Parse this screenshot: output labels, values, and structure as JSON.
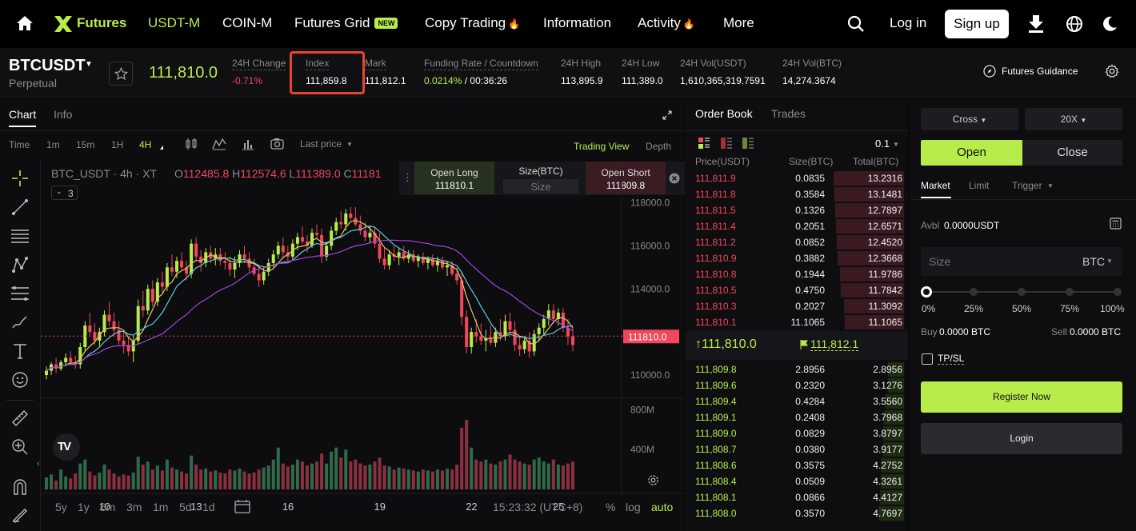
{
  "nav": {
    "logo": "Futures",
    "items": [
      "USDT-M",
      "COIN-M",
      "Futures Grid",
      "Copy Trading",
      "Information",
      "Activity",
      "More"
    ],
    "new_badge": "NEW",
    "login": "Log in",
    "signup": "Sign up"
  },
  "ticker": {
    "symbol": "BTCUSDT",
    "contract": "Perpetual",
    "last_price": "111,810.0",
    "change_label": "24H Change",
    "change_value": "-0.71%",
    "index_label": "Index",
    "index_value": "111,859.8",
    "mark_label": "Mark",
    "mark_value": "111,812.1",
    "funding_label": "Funding Rate / Countdown",
    "funding_rate": "0.0214%",
    "funding_sep": " / ",
    "countdown": "00:36:26",
    "high_label": "24H High",
    "high_value": "113,895.9",
    "low_label": "24H Low",
    "low_value": "111,389.0",
    "volu_label": "24H Vol(USDT)",
    "volu_value": "1,610,365,319.7591",
    "volb_label": "24H Vol(BTC)",
    "volb_value": "14,274.3674",
    "guidance": "Futures Guidance"
  },
  "chart": {
    "tabs": [
      "Chart",
      "Info"
    ],
    "intervals": [
      "Time",
      "1m",
      "15m",
      "1H",
      "4H"
    ],
    "price_type": "Last price",
    "views": [
      "Trading View",
      "Depth"
    ],
    "legend_pair": "BTC_USDT · 4h · XT",
    "ohlc": {
      "o_label": "O",
      "o": "112485.8",
      "h_label": "H",
      "h": "112574.6",
      "l_label": "L",
      "l": "111389.0",
      "c_label": "C",
      "c": "11181"
    },
    "indicator_count": "3",
    "open_long_label": "Open Long",
    "open_long_value": "111810.1",
    "size_label": "Size(BTC)",
    "size_placeholder": "Size",
    "open_short_label": "Open Short",
    "open_short_value": "111809.8",
    "price_axis": [
      "118000.0",
      "116000.0",
      "114000.0",
      "112000.0",
      "110000.0"
    ],
    "current_price_tag": "111810.0",
    "volume_axis": [
      "800M",
      "400M"
    ],
    "date_axis": [
      "10",
      "13",
      "16",
      "19",
      "22",
      "25"
    ],
    "ranges": [
      "5y",
      "1y",
      "6m",
      "3m",
      "1m",
      "5d",
      "1d"
    ],
    "clock": "15:23:32 (UTC+8)",
    "scale_opts": [
      "%",
      "log",
      "auto"
    ]
  },
  "chart_data": {
    "type": "candlestick",
    "price_range": [
      109000,
      118500
    ],
    "candles": [
      [
        110000,
        110400,
        109800,
        110200
      ],
      [
        110200,
        110600,
        110000,
        110500
      ],
      [
        110500,
        110800,
        110100,
        110300
      ],
      [
        110300,
        110700,
        110200,
        110600
      ],
      [
        110600,
        111000,
        110400,
        110800
      ],
      [
        110800,
        111100,
        110500,
        110600
      ],
      [
        110600,
        110900,
        110300,
        110500
      ],
      [
        110500,
        111500,
        110300,
        111300
      ],
      [
        111300,
        112500,
        111100,
        112300
      ],
      [
        112300,
        112900,
        111800,
        112000
      ],
      [
        112000,
        112400,
        111400,
        111600
      ],
      [
        111600,
        112200,
        111300,
        112000
      ],
      [
        112000,
        113000,
        111800,
        112800
      ],
      [
        112800,
        113400,
        112300,
        112500
      ],
      [
        112500,
        112900,
        111800,
        112100
      ],
      [
        112100,
        112500,
        111400,
        111600
      ],
      [
        111600,
        112000,
        111000,
        111400
      ],
      [
        111400,
        111800,
        110900,
        111100
      ],
      [
        111100,
        111800,
        110600,
        111600
      ],
      [
        111600,
        113500,
        111400,
        113200
      ],
      [
        113200,
        113900,
        112700,
        113000
      ],
      [
        113000,
        114200,
        112800,
        114000
      ],
      [
        114000,
        114400,
        113200,
        113400
      ],
      [
        113400,
        114500,
        113200,
        114300
      ],
      [
        114300,
        114800,
        113800,
        114100
      ],
      [
        114100,
        115200,
        113900,
        115000
      ],
      [
        115000,
        115600,
        114600,
        114800
      ],
      [
        114800,
        115500,
        114500,
        115300
      ],
      [
        115300,
        115700,
        114900,
        115000
      ],
      [
        115000,
        115300,
        114400,
        114700
      ],
      [
        114700,
        116300,
        114500,
        116100
      ],
      [
        116100,
        116400,
        115300,
        115500
      ],
      [
        115500,
        115800,
        114800,
        115200
      ],
      [
        115200,
        115900,
        115000,
        115700
      ],
      [
        115700,
        116000,
        115200,
        115400
      ],
      [
        115400,
        115900,
        115100,
        115600
      ],
      [
        115600,
        115900,
        115100,
        115300
      ],
      [
        115300,
        115700,
        114900,
        115200
      ],
      [
        115200,
        115500,
        114600,
        114900
      ],
      [
        114900,
        115500,
        114500,
        115200
      ],
      [
        115200,
        115800,
        115000,
        115600
      ],
      [
        115600,
        116000,
        115200,
        115400
      ],
      [
        115400,
        115700,
        114800,
        115000
      ],
      [
        115000,
        115400,
        114600,
        114700
      ],
      [
        114700,
        115100,
        114100,
        114400
      ],
      [
        114400,
        115000,
        114200,
        114800
      ],
      [
        114800,
        115400,
        114600,
        115200
      ],
      [
        115200,
        115800,
        115000,
        115600
      ],
      [
        115600,
        116200,
        115400,
        116000
      ],
      [
        116000,
        116400,
        115400,
        115700
      ],
      [
        115700,
        116000,
        115300,
        115500
      ],
      [
        115500,
        116300,
        115300,
        116100
      ],
      [
        116100,
        116600,
        115800,
        116400
      ],
      [
        116400,
        116900,
        116100,
        116200
      ],
      [
        116200,
        116500,
        115700,
        116000
      ],
      [
        116000,
        116800,
        115900,
        116600
      ],
      [
        116600,
        117000,
        116300,
        116500
      ],
      [
        116500,
        116800,
        115200,
        115500
      ],
      [
        115500,
        116200,
        115300,
        116000
      ],
      [
        116000,
        116900,
        115800,
        116700
      ],
      [
        116700,
        117300,
        116500,
        117100
      ],
      [
        117100,
        117600,
        116800,
        117000
      ],
      [
        117000,
        117700,
        116700,
        117500
      ],
      [
        117500,
        117800,
        117200,
        117300
      ],
      [
        117300,
        117800,
        116900,
        117000
      ],
      [
        117000,
        117400,
        116500,
        116700
      ],
      [
        116700,
        117100,
        116200,
        116400
      ],
      [
        116400,
        116900,
        116100,
        116600
      ],
      [
        116600,
        116900,
        115900,
        116100
      ],
      [
        116100,
        116600,
        115200,
        115400
      ],
      [
        115400,
        115900,
        114900,
        115100
      ],
      [
        115100,
        115800,
        114900,
        115600
      ],
      [
        115600,
        116000,
        115300,
        115500
      ],
      [
        115500,
        115900,
        115100,
        115700
      ],
      [
        115700,
        116000,
        115300,
        115400
      ],
      [
        115400,
        115800,
        115200,
        115600
      ],
      [
        115600,
        115800,
        115200,
        115300
      ],
      [
        115300,
        115600,
        115000,
        115500
      ],
      [
        115500,
        115700,
        115100,
        115200
      ],
      [
        115200,
        115500,
        114900,
        115400
      ],
      [
        115400,
        115600,
        115000,
        115100
      ],
      [
        115100,
        115500,
        114800,
        115300
      ],
      [
        115300,
        115500,
        114900,
        115000
      ],
      [
        115000,
        115300,
        114600,
        115100
      ],
      [
        115100,
        115300,
        114600,
        114700
      ],
      [
        114700,
        115000,
        114200,
        114400
      ],
      [
        114400,
        114800,
        112300,
        112700
      ],
      [
        112700,
        113000,
        111000,
        111300
      ],
      [
        111300,
        112200,
        111000,
        112000
      ],
      [
        112000,
        112600,
        111500,
        111800
      ],
      [
        111800,
        112400,
        111400,
        111600
      ],
      [
        111600,
        112100,
        111100,
        111700
      ],
      [
        111700,
        112300,
        111400,
        111500
      ],
      [
        111500,
        112200,
        111300,
        112000
      ],
      [
        112000,
        112600,
        111600,
        111800
      ],
      [
        111800,
        112800,
        111600,
        112500
      ],
      [
        112500,
        112900,
        111900,
        112100
      ],
      [
        112100,
        112500,
        111100,
        111400
      ],
      [
        111400,
        111800,
        110900,
        111200
      ],
      [
        111200,
        111800,
        111000,
        111600
      ],
      [
        111600,
        112000,
        110800,
        111100
      ],
      [
        111100,
        112100,
        110900,
        111900
      ],
      [
        111900,
        112400,
        111600,
        112200
      ],
      [
        112200,
        112800,
        111900,
        112600
      ],
      [
        112600,
        113300,
        112300,
        113000
      ],
      [
        113000,
        113300,
        112400,
        112600
      ],
      [
        112600,
        113100,
        112300,
        112900
      ],
      [
        112900,
        113100,
        112000,
        112200
      ],
      [
        112200,
        112600,
        111400,
        111800
      ],
      [
        111800,
        112200,
        111100,
        111400
      ]
    ],
    "volume_max": 900,
    "volumes": [
      120,
      150,
      90,
      200,
      130,
      110,
      160,
      260,
      300,
      180,
      140,
      170,
      250,
      200,
      160,
      130,
      150,
      140,
      170,
      330,
      250,
      280,
      200,
      240,
      190,
      300,
      220,
      200,
      180,
      160,
      340,
      250,
      200,
      210,
      180,
      190,
      170,
      160,
      200,
      190,
      210,
      180,
      160,
      170,
      200,
      220,
      240,
      300,
      420,
      260,
      230,
      250,
      300,
      280,
      240,
      260,
      280,
      360,
      260,
      380,
      420,
      320,
      400,
      280,
      300,
      260,
      240,
      250,
      280,
      320,
      240,
      230,
      200,
      220,
      210,
      200,
      190,
      180,
      200,
      190,
      180,
      200,
      190,
      210,
      200,
      250,
      620,
      700,
      420,
      300,
      280,
      300,
      260,
      250,
      280,
      300,
      350,
      300,
      280,
      260,
      250,
      300,
      320,
      280,
      260,
      300,
      250,
      240,
      260,
      280,
      300,
      260
    ],
    "ma_lines": [
      "yellow",
      "cyan",
      "purple"
    ]
  },
  "orderbook": {
    "tabs": [
      "Order Book",
      "Trades"
    ],
    "precision": "0.1",
    "headers": [
      "Price(USDT)",
      "Size(BTC)",
      "Total(BTC)"
    ],
    "asks": [
      [
        "111,811.9",
        "0.0835",
        "13.2316"
      ],
      [
        "111,811.8",
        "0.3584",
        "13.1481"
      ],
      [
        "111,811.5",
        "0.1326",
        "12.7897"
      ],
      [
        "111,811.4",
        "0.2051",
        "12.6571"
      ],
      [
        "111,811.2",
        "0.0852",
        "12.4520"
      ],
      [
        "111,810.9",
        "0.3882",
        "12.3668"
      ],
      [
        "111,810.8",
        "0.1944",
        "11.9786"
      ],
      [
        "111,810.5",
        "0.4750",
        "11.7842"
      ],
      [
        "111,810.3",
        "0.2027",
        "11.3092"
      ],
      [
        "111,810.1",
        "11.1065",
        "11.1065"
      ]
    ],
    "ask_depth": [
      0.95,
      0.94,
      0.92,
      0.91,
      0.9,
      0.89,
      0.86,
      0.85,
      0.81,
      0.8
    ],
    "last_price": "111,810.0",
    "mark_price": "111,812.1",
    "bids": [
      [
        "111,809.8",
        "2.8956",
        "2.8956"
      ],
      [
        "111,809.6",
        "0.2320",
        "3.1276"
      ],
      [
        "111,809.4",
        "0.4284",
        "3.5560"
      ],
      [
        "111,809.1",
        "0.2408",
        "3.7968"
      ],
      [
        "111,809.0",
        "0.0829",
        "3.8797"
      ],
      [
        "111,808.7",
        "0.0380",
        "3.9177"
      ],
      [
        "111,808.6",
        "0.3575",
        "4.2752"
      ],
      [
        "111,808.4",
        "0.0509",
        "4.3261"
      ],
      [
        "111,808.1",
        "0.0866",
        "4.4127"
      ],
      [
        "111,808.0",
        "0.3570",
        "4.7697"
      ]
    ],
    "bid_depth": [
      0.21,
      0.22,
      0.25,
      0.27,
      0.28,
      0.28,
      0.31,
      0.31,
      0.32,
      0.34
    ]
  },
  "trade": {
    "margin_mode": "Cross",
    "leverage": "20X",
    "open_label": "Open",
    "close_label": "Close",
    "order_types": [
      "Market",
      "Limit",
      "Trigger"
    ],
    "avbl_label": "Avbl",
    "avbl_value": "0.0000USDT",
    "size_placeholder": "Size",
    "size_unit": "BTC",
    "slider_marks": [
      "0%",
      "25%",
      "50%",
      "75%",
      "100%"
    ],
    "slider_value": 0,
    "buy_label": "Buy",
    "buy_value": "0.0000 BTC",
    "sell_label": "Sell",
    "sell_value": "0.0000 BTC",
    "tpsl_label": "TP/SL",
    "register_label": "Register Now",
    "login_label": "Login"
  },
  "colors": {
    "accent": "#b8ec4a",
    "up": "#b8ec4a",
    "down": "#f0475b",
    "highlight_box": "#e8442f"
  }
}
